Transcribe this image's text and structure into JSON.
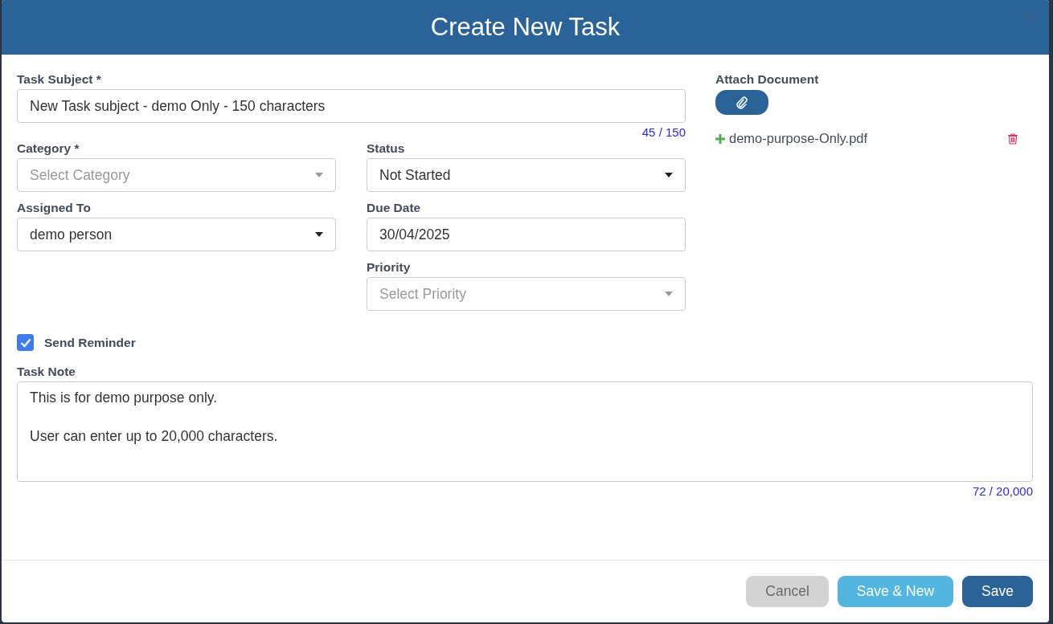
{
  "dialog": {
    "title": "Create New Task"
  },
  "subject": {
    "label": "Task Subject *",
    "value": "New Task subject - demo Only - 150 characters",
    "counter": "45 / 150"
  },
  "fields": [
    {
      "label": "Category *",
      "kind": "select",
      "placeholder": "Select Category"
    },
    {
      "label": "Status",
      "kind": "select",
      "value": "Not Started"
    },
    {
      "label": "Assigned To",
      "kind": "select",
      "value": "demo person"
    },
    {
      "label": "Due Date",
      "kind": "date",
      "value": "30/04/2025"
    },
    {
      "label": "Priority",
      "kind": "select",
      "placeholder": "Select Priority"
    }
  ],
  "attach": {
    "label": "Attach Document",
    "files": [
      {
        "name": "demo-purpose-Only.pdf"
      }
    ]
  },
  "reminder": {
    "label": "Send Reminder",
    "checked": true
  },
  "note": {
    "label": "Task Note",
    "value": "This is for demo purpose only.\n\nUser can enter up to 20,000 characters.",
    "counter": "72 / 20,000"
  },
  "buttons": [
    {
      "label": "Cancel",
      "kind": "secondary",
      "disabled": true
    },
    {
      "label": "Save & New",
      "kind": "info",
      "disabled": false
    },
    {
      "label": "Save",
      "kind": "primary",
      "disabled": false
    }
  ]
}
